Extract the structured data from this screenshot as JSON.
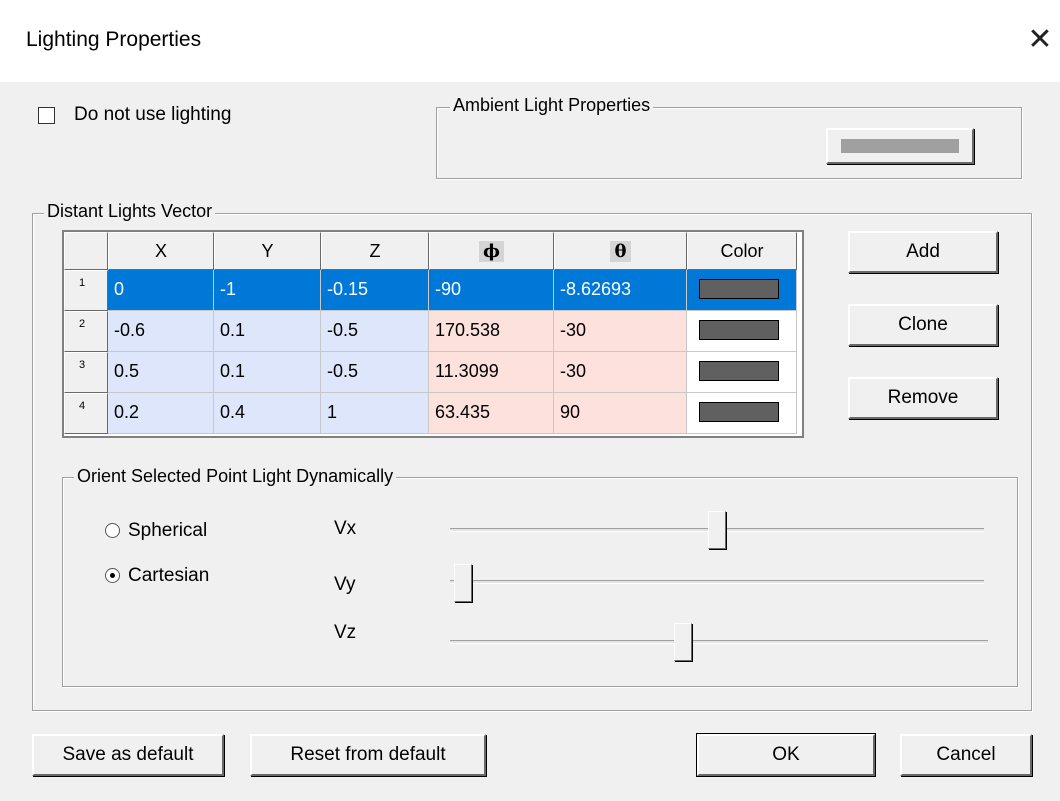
{
  "window": {
    "title": "Lighting Properties",
    "close_glyph": "✕"
  },
  "lighting": {
    "disable_label": "Do not use lighting",
    "disabled": false
  },
  "ambient": {
    "label": "Ambient Light Properties",
    "color": "#a0a0a0"
  },
  "distant": {
    "label": "Distant Lights Vector",
    "columns": [
      "X",
      "Y",
      "Z",
      "ϕ",
      "θ",
      "Color"
    ],
    "rows": [
      {
        "n": "1",
        "x": "0",
        "y": "-1",
        "z": "-0.15",
        "phi": "-90",
        "theta": "-8.62693",
        "color": "#606060",
        "selected": true
      },
      {
        "n": "2",
        "x": "-0.6",
        "y": "0.1",
        "z": "-0.5",
        "phi": "170.538",
        "theta": "-30",
        "color": "#606060",
        "selected": false
      },
      {
        "n": "3",
        "x": "0.5",
        "y": "0.1",
        "z": "-0.5",
        "phi": "11.3099",
        "theta": "-30",
        "color": "#606060",
        "selected": false
      },
      {
        "n": "4",
        "x": "0.2",
        "y": "0.4",
        "z": "1",
        "phi": "63.435",
        "theta": "90",
        "color": "#606060",
        "selected": false
      }
    ],
    "buttons": {
      "add": "Add",
      "clone": "Clone",
      "remove": "Remove"
    }
  },
  "orient": {
    "label": "Orient Selected Point Light Dynamically",
    "modes": [
      {
        "label": "Spherical",
        "selected": false
      },
      {
        "label": "Cartesian",
        "selected": true
      }
    ],
    "sliders": [
      {
        "label": "Vx",
        "value": 0.5
      },
      {
        "label": "Vy",
        "value": 0.0
      },
      {
        "label": "Vz",
        "value": 0.43
      }
    ]
  },
  "footer": {
    "save_default": "Save as default",
    "reset_default": "Reset from default",
    "ok": "OK",
    "cancel": "Cancel"
  },
  "colors": {
    "selected_row": "#0078d7",
    "xyz_bg": "#dde6fb",
    "angle_bg": "#fde1dc"
  }
}
